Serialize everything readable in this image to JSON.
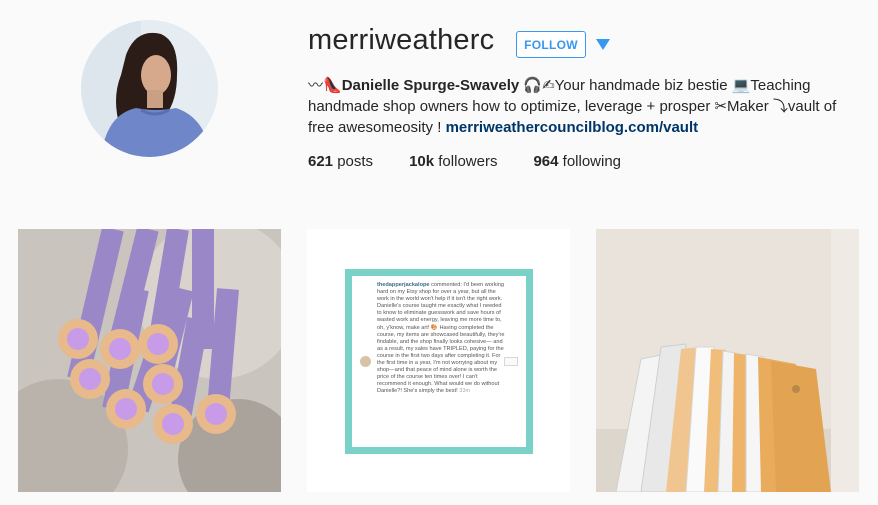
{
  "profile": {
    "username": "merriweatherc",
    "follow_label": "FOLLOW",
    "bio_prefix": "〰👠",
    "display_name": "Danielle Spurge-Swavely",
    "bio_line": " 🎧✍Your handmade biz bestie 💻Teaching handmade shop owners how to optimize, leverage + prosper ✂Maker ⤵vault of free awesomeosity ! ",
    "link": "merriweathercouncilblog.com/vault"
  },
  "stats": {
    "posts_count": "621",
    "posts_label": "posts",
    "followers_count": "10k",
    "followers_label": "followers",
    "following_count": "964",
    "following_label": "following"
  },
  "posts": [
    {
      "subject": "purple-pencils"
    },
    {
      "subject": "comment-screenshot",
      "comment_user": "thedapperjackalope",
      "comment_body": " commented: I'd been working hard on my Etsy shop for over a year, but all the work in the world won't help if it isn't the right work. Danielle's course taught me exactly what I needed to know to eliminate guesswork and save hours of wasted work and energy, leaving me more time to, oh, y'know, make art! 🎨 Having completed the course, my items are showcased beautifully, they're findable, and the shop finally looks cohesive— and as a result, my sales have TRIPLED, paying for the course in the first two days after completing it. For the first time in a year, I'm not worrying about my shop—and that peace of mind alone is worth the price of the course ten times over! I can't recommend it enough. What would we do without Danielle?! She's simply the best! ",
      "comment_time": "33m"
    },
    {
      "subject": "envelopes"
    }
  ],
  "colors": {
    "accent": "#3897f0",
    "link": "#003569",
    "frame": "#79d1c8"
  }
}
